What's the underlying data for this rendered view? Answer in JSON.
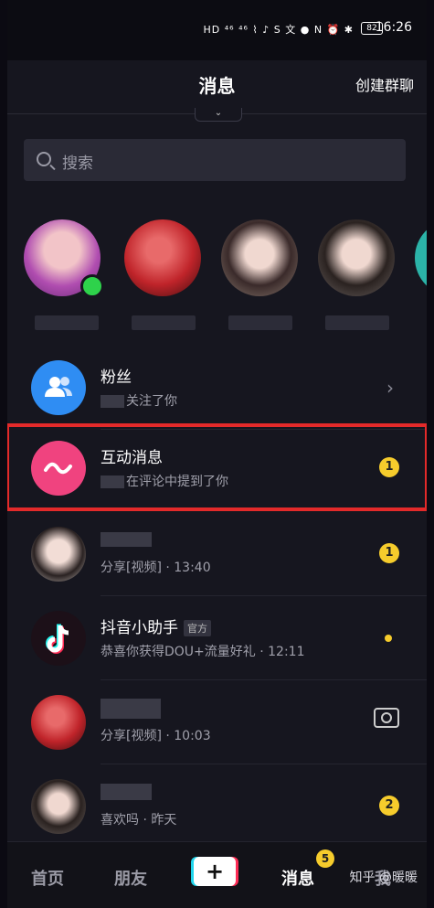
{
  "status_bar": {
    "icons": "HD ⁴⁶ ⁴⁶ ⌇ ♪ S 文 ● N ⏰ ✱",
    "battery": "82",
    "time": "16:26"
  },
  "header": {
    "title": "消息",
    "create_group": "创建群聊"
  },
  "search": {
    "placeholder": "搜索"
  },
  "rows": [
    {
      "name": "粉丝",
      "sub": "关注了你"
    },
    {
      "name": "互动消息",
      "sub": "在评论中提到了你",
      "badge": "1"
    },
    {
      "name": "",
      "sub": "分享[视频] · 13:40",
      "badge": "1"
    },
    {
      "name": "抖音小助手",
      "tag": "官方",
      "sub": "恭喜你获得DOU+流量好礼 · 12:11"
    },
    {
      "name": "",
      "sub": "分享[视频] · 10:03"
    },
    {
      "name": "",
      "sub": "喜欢吗 · 昨天",
      "badge": "2"
    }
  ],
  "tabs": {
    "home": "首页",
    "friends": "朋友",
    "plus": "+",
    "messages": "消息",
    "messages_badge": "5",
    "me": "我"
  },
  "watermark": "知乎 @暖暖",
  "colors": {
    "background": "#16161f",
    "badge": "#f6cc2c",
    "highlight": "#e32a2a",
    "online": "#2ed24b"
  }
}
